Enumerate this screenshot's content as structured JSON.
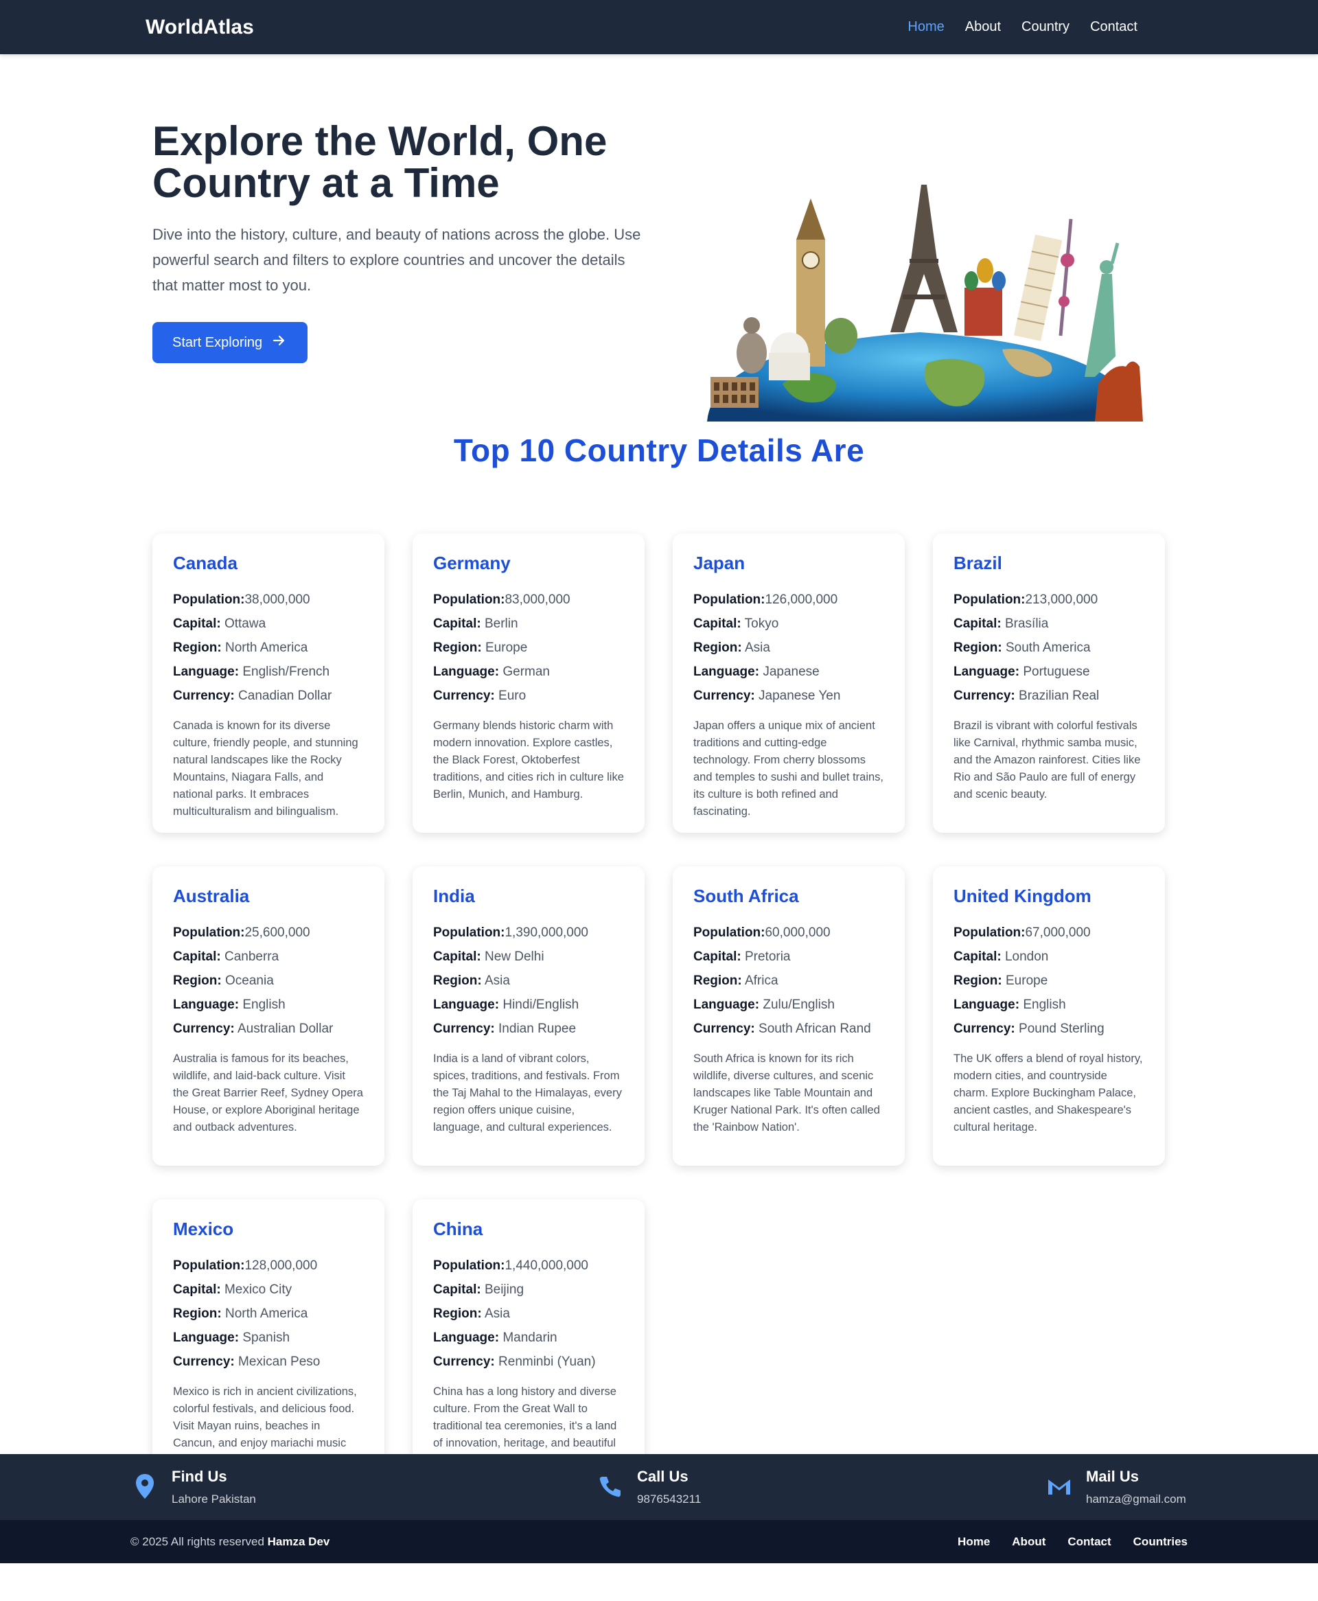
{
  "header": {
    "brand": "WorldAtlas",
    "nav": [
      "Home",
      "About",
      "Country",
      "Contact"
    ]
  },
  "hero": {
    "title": "Explore the World, One Country at a Time",
    "description": "Dive into the history, culture, and beauty of nations across the globe. Use powerful search and filters to explore countries and uncover the details that matter most to you.",
    "button": "Start Exploring"
  },
  "section": {
    "title": "Top 10 Country Details Are"
  },
  "labels": {
    "population": "Population:",
    "capital": "Capital:",
    "region": "Region:",
    "language": "Language:",
    "currency": "Currency:"
  },
  "countries": [
    {
      "name": "Canada",
      "population": "38,000,000",
      "capital": "Ottawa",
      "region": "North America",
      "language": "English/French",
      "currency": "Canadian Dollar",
      "description": "Canada is known for its diverse culture, friendly people, and stunning natural landscapes like the Rocky Mountains, Niagara Falls, and national parks. It embraces multiculturalism and bilingualism."
    },
    {
      "name": "Germany",
      "population": "83,000,000",
      "capital": "Berlin",
      "region": "Europe",
      "language": "German",
      "currency": "Euro",
      "description": "Germany blends historic charm with modern innovation. Explore castles, the Black Forest, Oktoberfest traditions, and cities rich in culture like Berlin, Munich, and Hamburg."
    },
    {
      "name": "Japan",
      "population": "126,000,000",
      "capital": "Tokyo",
      "region": "Asia",
      "language": "Japanese",
      "currency": "Japanese Yen",
      "description": "Japan offers a unique mix of ancient traditions and cutting-edge technology. From cherry blossoms and temples to sushi and bullet trains, its culture is both refined and fascinating."
    },
    {
      "name": "Brazil",
      "population": "213,000,000",
      "capital": "Brasília",
      "region": "South America",
      "language": "Portuguese",
      "currency": "Brazilian Real",
      "description": "Brazil is vibrant with colorful festivals like Carnival, rhythmic samba music, and the Amazon rainforest. Cities like Rio and São Paulo are full of energy and scenic beauty."
    },
    {
      "name": "Australia",
      "population": "25,600,000",
      "capital": "Canberra",
      "region": "Oceania",
      "language": "English",
      "currency": "Australian Dollar",
      "description": "Australia is famous for its beaches, wildlife, and laid-back culture. Visit the Great Barrier Reef, Sydney Opera House, or explore Aboriginal heritage and outback adventures."
    },
    {
      "name": "India",
      "population": "1,390,000,000",
      "capital": "New Delhi",
      "region": "Asia",
      "language": "Hindi/English",
      "currency": "Indian Rupee",
      "description": "India is a land of vibrant colors, spices, traditions, and festivals. From the Taj Mahal to the Himalayas, every region offers unique cuisine, language, and cultural experiences."
    },
    {
      "name": "South Africa",
      "population": "60,000,000",
      "capital": "Pretoria",
      "region": "Africa",
      "language": "Zulu/English",
      "currency": "South African Rand",
      "description": "South Africa is known for its rich wildlife, diverse cultures, and scenic landscapes like Table Mountain and Kruger National Park. It's often called the 'Rainbow Nation'."
    },
    {
      "name": "United Kingdom",
      "population": "67,000,000",
      "capital": "London",
      "region": "Europe",
      "language": "English",
      "currency": "Pound Sterling",
      "description": "The UK offers a blend of royal history, modern cities, and countryside charm. Explore Buckingham Palace, ancient castles, and Shakespeare's cultural heritage."
    },
    {
      "name": "Mexico",
      "population": "128,000,000",
      "capital": "Mexico City",
      "region": "North America",
      "language": "Spanish",
      "currency": "Mexican Peso",
      "description": "Mexico is rich in ancient civilizations, colorful festivals, and delicious food. Visit Mayan ruins, beaches in Cancun, and enjoy mariachi music and tacos."
    },
    {
      "name": "China",
      "population": "1,440,000,000",
      "capital": "Beijing",
      "region": "Asia",
      "language": "Mandarin",
      "currency": "Renminbi (Yuan)",
      "description": "China has a long history and diverse culture. From the Great Wall to traditional tea ceremonies, it's a land of innovation, heritage, and beautiful landscapes."
    }
  ],
  "footer": {
    "find": {
      "title": "Find Us",
      "text": "Lahore Pakistan"
    },
    "call": {
      "title": "Call Us",
      "text": "9876543211"
    },
    "mail": {
      "title": "Mail Us",
      "text": "hamza@gmail.com"
    },
    "copyright": "© 2025 All rights reserved",
    "author": "Hamza Dev",
    "nav": [
      "Home",
      "About",
      "Contact",
      "Countries"
    ]
  },
  "colors": {
    "header_bg": "#1e293b",
    "accent": "#2563eb",
    "card_title": "#1d4ed8",
    "nav_active": "#60a5fa"
  }
}
